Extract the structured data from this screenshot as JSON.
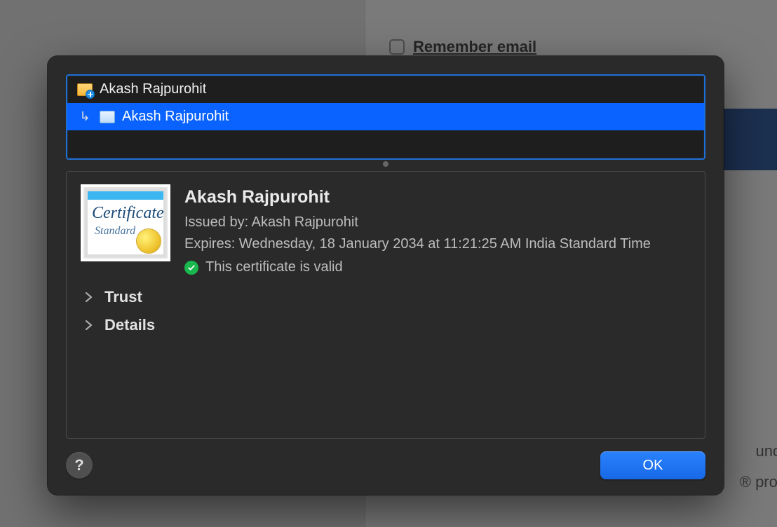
{
  "background": {
    "remember_label": "Remember email",
    "snippet1": "unoff",
    "snippet2": "® proje"
  },
  "cert_list": {
    "root": {
      "label": "Akash Rajpurohit"
    },
    "child": {
      "label": "Akash Rajpurohit"
    }
  },
  "cert_badge": {
    "script": "Certificate",
    "standard": "Standard"
  },
  "details": {
    "name": "Akash Rajpurohit",
    "issued_by": "Issued by: Akash Rajpurohit",
    "expires": "Expires: Wednesday, 18 January 2034 at 11:21:25 AM India Standard Time",
    "valid": "This certificate is valid"
  },
  "disclosure": {
    "trust": "Trust",
    "details": "Details"
  },
  "footer": {
    "help": "?",
    "ok": "OK"
  }
}
